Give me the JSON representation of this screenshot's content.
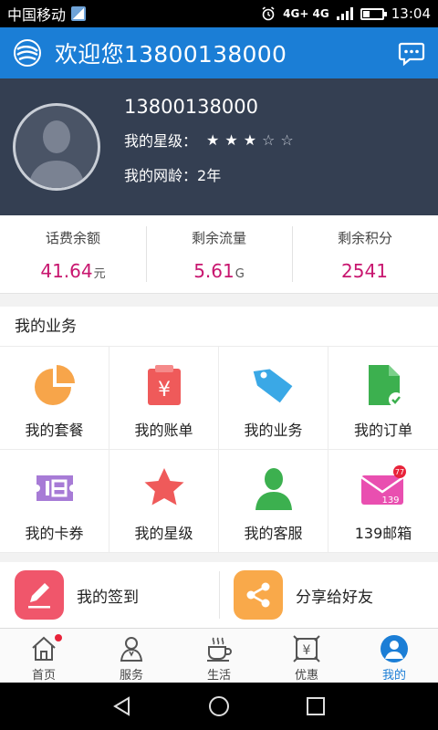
{
  "status_bar": {
    "carrier": "中国移动",
    "network": "4G+ 4G",
    "time": "13:04",
    "battery_level": 0.35
  },
  "header": {
    "title": "欢迎您13800138000",
    "brand_color": "#1b7ed6",
    "message_icon": "chat-bubble-icon"
  },
  "profile": {
    "phone": "13800138000",
    "star_label": "我的星级：",
    "star_rating": 3,
    "star_max": 5,
    "tenure_label": "我的网龄：",
    "tenure_value": "2年"
  },
  "balance": {
    "items": [
      {
        "label": "话费余额",
        "value": "41.64",
        "unit": "元"
      },
      {
        "label": "剩余流量",
        "value": "5.61",
        "unit": "G"
      },
      {
        "label": "剩余积分",
        "value": "2541",
        "unit": ""
      }
    ],
    "value_color": "#c8166f"
  },
  "services": {
    "title": "我的业务",
    "items": [
      {
        "label": "我的套餐",
        "icon": "pie-chart-icon",
        "color": "#f7a54a"
      },
      {
        "label": "我的账单",
        "icon": "bill-icon",
        "color": "#ef5a5a"
      },
      {
        "label": "我的业务",
        "icon": "tag-icon",
        "color": "#3aa8e6"
      },
      {
        "label": "我的订单",
        "icon": "order-doc-icon",
        "color": "#3cb04f"
      },
      {
        "label": "我的卡券",
        "icon": "coupon-icon",
        "color": "#a77bd6"
      },
      {
        "label": "我的星级",
        "icon": "star-icon",
        "color": "#ef5a5a"
      },
      {
        "label": "我的客服",
        "icon": "service-person-icon",
        "color": "#3cb04f"
      },
      {
        "label": "139邮箱",
        "icon": "mail-icon",
        "color": "#e94fb0",
        "badge": "77"
      }
    ]
  },
  "quick_actions": [
    {
      "label": "我的签到",
      "icon": "pencil-icon",
      "color": "#f0566b"
    },
    {
      "label": "分享给好友",
      "icon": "share-icon",
      "color": "#f9a94a"
    }
  ],
  "tabbar": {
    "tabs": [
      {
        "label": "首页",
        "icon": "home-icon",
        "has_dot": true
      },
      {
        "label": "服务",
        "icon": "service-icon",
        "has_dot": false
      },
      {
        "label": "生活",
        "icon": "coffee-icon",
        "has_dot": false
      },
      {
        "label": "优惠",
        "icon": "discount-icon",
        "has_dot": false
      },
      {
        "label": "我的",
        "icon": "user-icon",
        "has_dot": false,
        "active": true
      }
    ],
    "active_color": "#1b7ed6"
  }
}
